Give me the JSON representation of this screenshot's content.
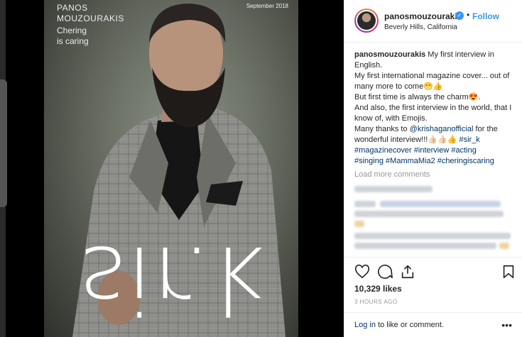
{
  "cover": {
    "name": "PANOS\nMOUZOURAKIS",
    "tagline": "Chering\nis caring",
    "date": "September 2018",
    "logo": "sir.k"
  },
  "post": {
    "username": "panosmouzourakis",
    "verified": true,
    "dot": "•",
    "follow_label": "Follow",
    "location": "Beverly Hills, California",
    "caption": {
      "username": "panosmouzourakis",
      "line1": " My first interview in English.",
      "line2": "My first international magazine cover... out of many more to come😁👍",
      "line3": "But first time is always the charm😍.",
      "line4": "And also, the first interview in the world, that I know of, with Emojis.",
      "line5_pre": "Many thanks to ",
      "mention": "@krishaganofficial",
      "line5_post": " for the wonderful interview!!!👍🏻👍🏻👍 ",
      "tag1": "#sir_k",
      "tag2": "#magazinecover",
      "tag3": "#interview",
      "tag4": "#acting",
      "tag5": "#singing",
      "tag6": "#MammaMia2",
      "tag7": "#cheringiscaring"
    },
    "load_more": "Load more comments",
    "likes": "10,329 likes",
    "time_ago": "3 HOURS AGO",
    "login_link": "Log in",
    "login_rest": " to like or comment.",
    "more_dots": "•••"
  },
  "icons": [
    "heart-icon",
    "comment-icon",
    "share-icon",
    "bookmark-icon"
  ],
  "colors": {
    "accent": "#3897f0",
    "link": "#003569",
    "text": "#262626",
    "muted": "#999999"
  }
}
